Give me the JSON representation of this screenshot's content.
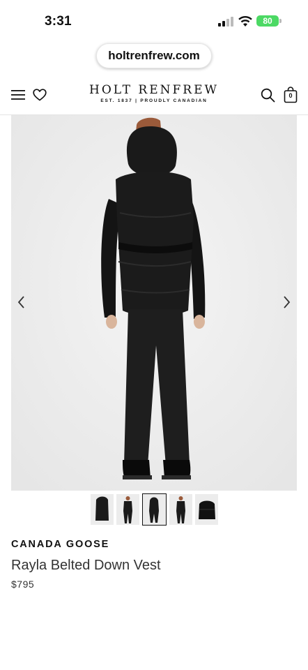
{
  "status_bar": {
    "time": "3:31",
    "battery": "80"
  },
  "browser": {
    "url": "holtrenfrew.com"
  },
  "header": {
    "logo_main": "HOLT RENFREW",
    "logo_tagline": "EST. 1837 | PROUDLY CANADIAN",
    "bag_count": "0"
  },
  "gallery": {
    "thumbnail_count": 5,
    "selected_index": 2
  },
  "product": {
    "brand": "CANADA GOOSE",
    "name": "Rayla Belted Down Vest",
    "price": "$795"
  },
  "colors": {
    "accent": "#111111",
    "battery": "#4cd964",
    "image_bg": "#ececec"
  }
}
